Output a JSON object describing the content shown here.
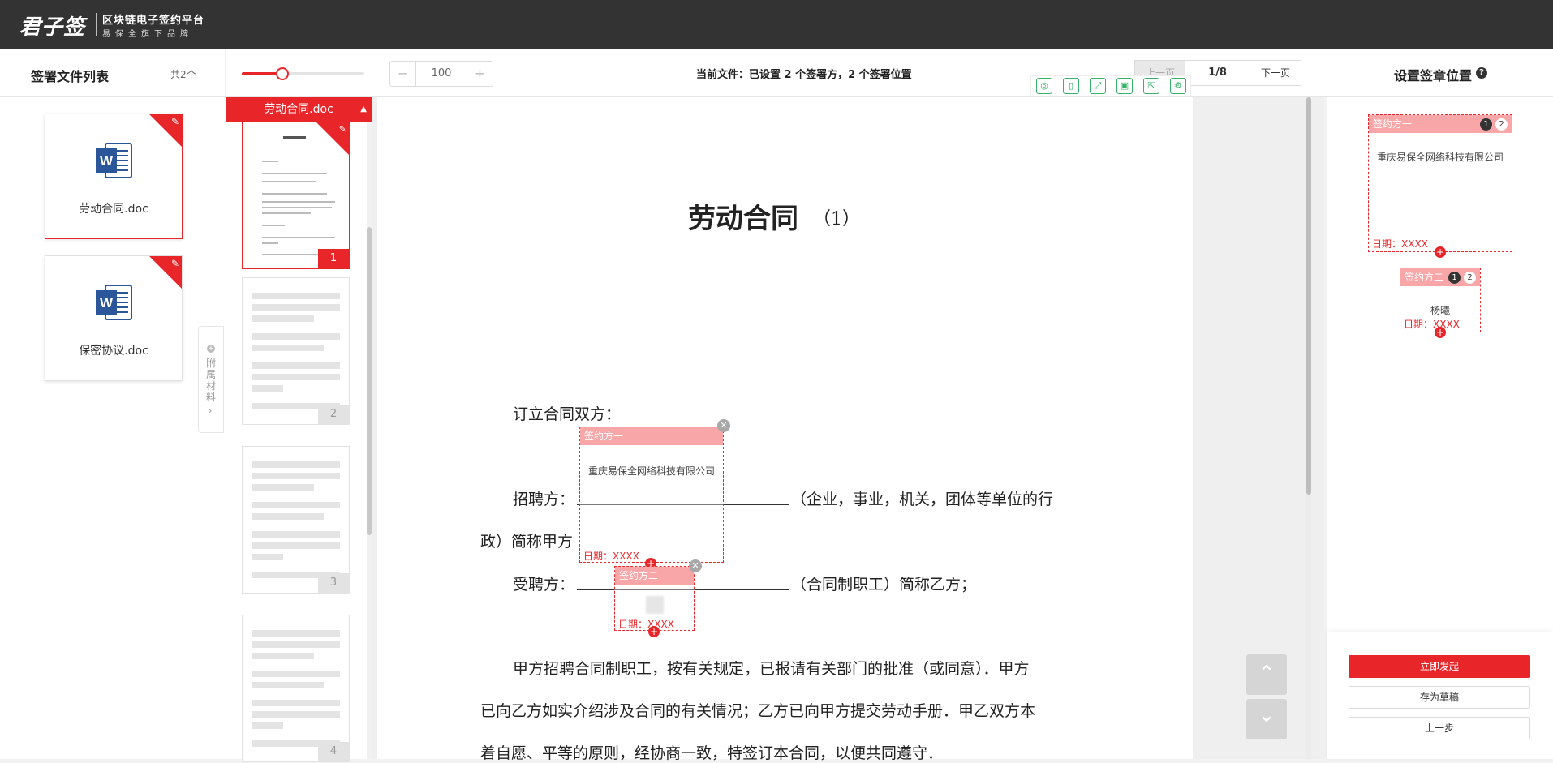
{
  "header": {
    "logo_main": "君子签",
    "logo_sub1": "区块链电子签约平台",
    "logo_sub2": "易保全旗下品牌"
  },
  "left_panel": {
    "title": "签署文件列表",
    "count": "共2个",
    "files": [
      {
        "name": "劳动合同.doc"
      },
      {
        "name": "保密协议.doc"
      }
    ],
    "attach_label": "附属材料"
  },
  "toolbar": {
    "zoom_value": "100",
    "zoom_slider_fraction": 0.33,
    "current_file_status": "当前文件：已设置 2 个签署方，2 个签署位置",
    "prev_label": "上一页",
    "page_indicator": "1/8",
    "next_label": "下一页",
    "decrease": "−",
    "increase": "+"
  },
  "thumbnails": {
    "header": "劳动合同.doc",
    "pages": [
      "1",
      "2",
      "3",
      "4"
    ]
  },
  "document": {
    "title": "劳动合同",
    "title_suffix": "（1）",
    "line_parties": "订立合同双方：",
    "line_employer_label": "招聘方：",
    "line_employer_suffix": "（企业，事业，机关，团体等单位的行",
    "line_employer_cont": "政）简称甲方",
    "line_employee_label": "受聘方：",
    "line_employee_suffix": "（合同制职工）简称乙方；",
    "para1_line1": "甲方招聘合同制职工，按有关规定，已报请有关部门的批准（或同意）．甲方",
    "para1_line2": "已向乙方如实介绍涉及合同的有关情况；乙方已向甲方提交劳动手册．甲乙双方本",
    "para1_line3": "着自愿、平等的原则，经协商一致，特签订本合同，以便共同遵守．"
  },
  "signature_boxes": {
    "party1": {
      "header": "签约方一",
      "name": "重庆易保全网络科技有限公司",
      "date": "日期：XXXX"
    },
    "party2": {
      "header": "签约方二",
      "date": "日期：XXXX"
    }
  },
  "right_panel": {
    "title": "设置签章位置",
    "party1": {
      "header": "签约方一",
      "badge1": "1",
      "badge2": "2",
      "name": "重庆易保全网络科技有限公司",
      "date": "日期：XXXX"
    },
    "party2": {
      "header": "签约方二",
      "badge1": "1",
      "badge2": "2",
      "name": "杨曦",
      "date": "日期：XXXX"
    },
    "btn_launch": "立即发起",
    "btn_draft": "存为草稿",
    "btn_back": "上一步"
  },
  "colors": {
    "accent": "#e8262a",
    "header_bg": "#333333",
    "tool_green": "#37b26a",
    "seal_pink": "#f8a6a7"
  }
}
